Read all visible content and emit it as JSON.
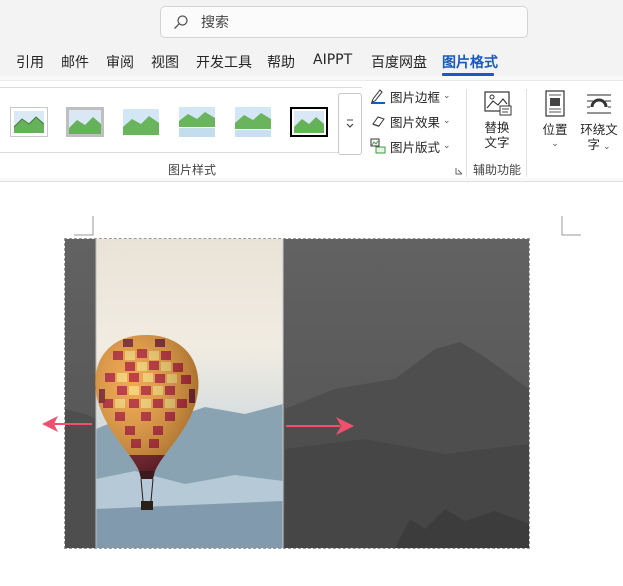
{
  "search": {
    "placeholder": "搜索",
    "icon": "search-icon"
  },
  "menu": {
    "tabs": [
      {
        "label": "引用"
      },
      {
        "label": "邮件"
      },
      {
        "label": "审阅"
      },
      {
        "label": "视图"
      },
      {
        "label": "开发工具"
      },
      {
        "label": "帮助"
      },
      {
        "label": "AIPPT"
      },
      {
        "label": "百度网盘"
      },
      {
        "label": "图片格式",
        "active": true
      }
    ]
  },
  "ribbon": {
    "picture_styles": {
      "label": "图片样式",
      "thumbnail_count": 6,
      "more_icon": "chevron-down-more-icon"
    },
    "commands": {
      "border": "图片边框",
      "effects": "图片效果",
      "layout": "图片版式"
    },
    "accessibility": {
      "alt_text_line1": "替换",
      "alt_text_line2": "文字",
      "label": "辅助功能"
    },
    "arrange": {
      "position": "位置",
      "wrap_line1": "环绕文",
      "wrap_line2": "字"
    }
  },
  "colors": {
    "accent": "#185abd",
    "arrow": "#f0506e",
    "picture_gray": "#5a5a5a",
    "ribbon_bg": "#f3f3f3"
  }
}
